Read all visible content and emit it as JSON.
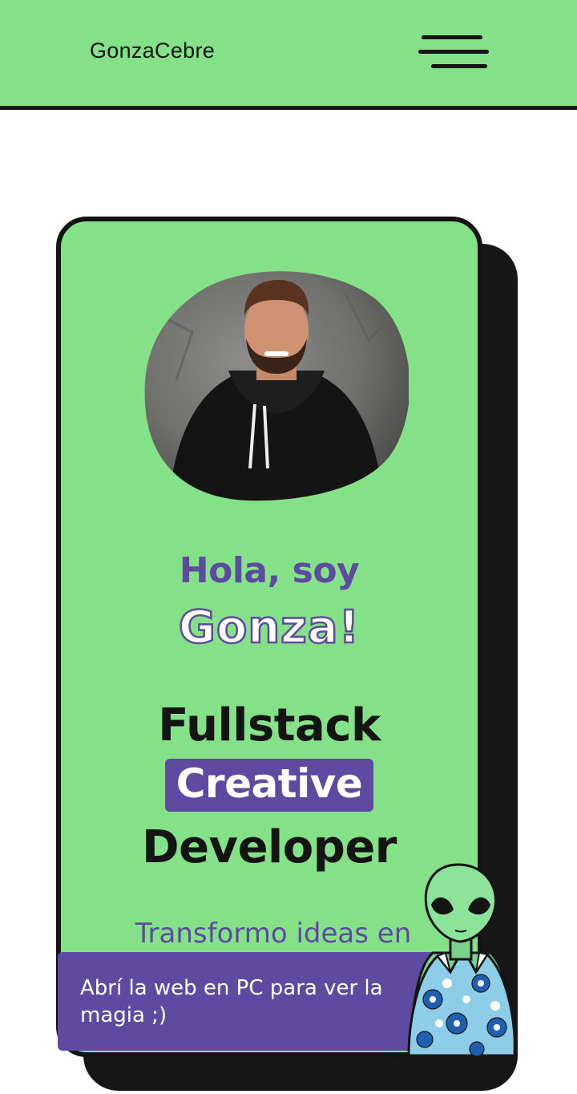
{
  "header": {
    "brand": "GonzaCebre",
    "menu_icon": "hamburger-menu-icon"
  },
  "hero": {
    "avatar_alt": "Gonza profile photo",
    "greeting_line1": "Hola, soy",
    "greeting_name": "Gonza!",
    "role_line1": "Fullstack",
    "role_highlight": "Creative",
    "role_line3": "Developer",
    "tagline": "Transformo ideas en páginas (y en experiencias)"
  },
  "toast": {
    "message": "Abrí la web en PC para ver la magia ;)",
    "mascot": "alien-mascot-icon"
  },
  "colors": {
    "accent_green": "#84e187",
    "accent_purple": "#5e4aa0",
    "ink": "#141414"
  }
}
